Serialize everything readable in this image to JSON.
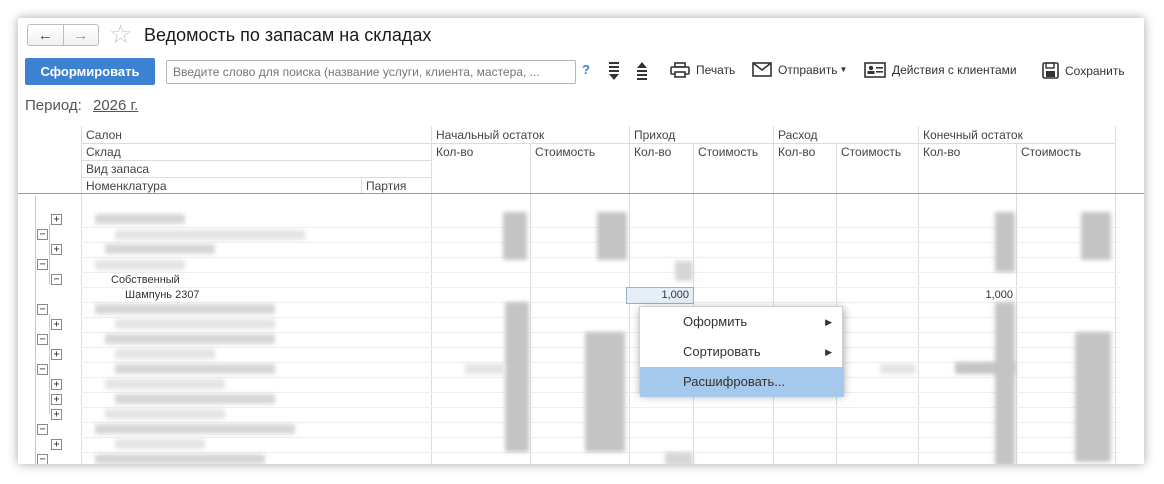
{
  "window": {
    "title": "Ведомость по запасам на складах",
    "nav_back": "←",
    "nav_forward": "→",
    "favorite_icon": "☆"
  },
  "toolbar": {
    "generate_label": "Сформировать",
    "search_placeholder": "Введите слово для поиска (название услуги, клиента, мастера, ...",
    "help_label": "?",
    "print_label": "Печать",
    "send_label": "Отправить",
    "client_actions_label": "Действия с клиентами",
    "save_label": "Сохранить",
    "accent_color": "#3c82d3"
  },
  "period": {
    "label": "Период:",
    "value": "2026 г."
  },
  "table": {
    "header_rows": [
      "Салон",
      "Склад",
      "Вид запаса",
      "Номенклатура"
    ],
    "party_label": "Партия",
    "groups": {
      "start": "Начальный остаток",
      "income": "Приход",
      "expense": "Расход",
      "end": "Конечный остаток"
    },
    "qty_label": "Кол-во",
    "cost_label": "Стоимость",
    "visible_rows": {
      "stock_type": "Собственный",
      "item": "Шампунь 2307",
      "income_qty": "1,000",
      "end_qty": "1,000"
    }
  },
  "context_menu": {
    "items": [
      {
        "label": "Оформить",
        "submenu": true
      },
      {
        "label": "Сортировать",
        "submenu": true
      },
      {
        "label": "Расшифровать...",
        "submenu": false
      }
    ]
  }
}
